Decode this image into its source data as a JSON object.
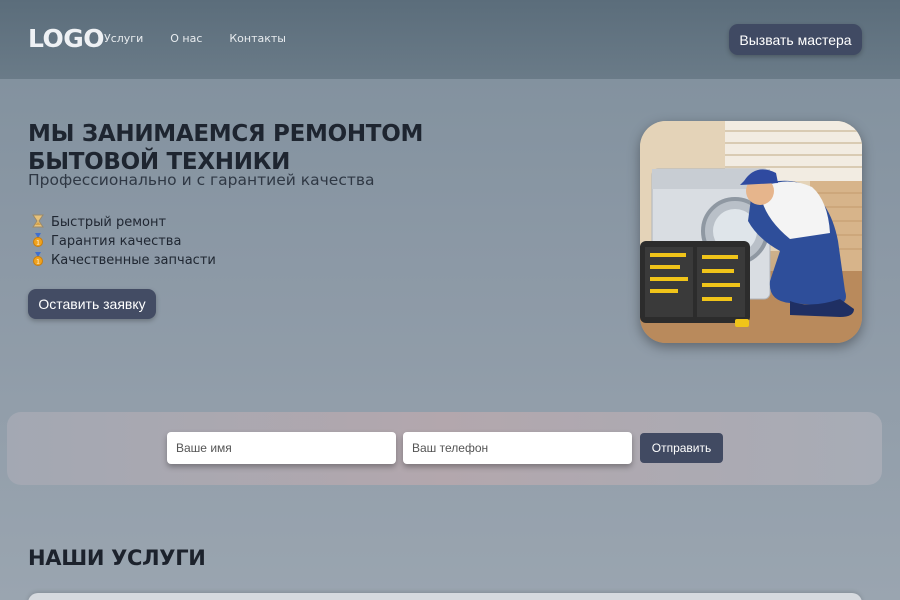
{
  "header": {
    "logo": "LOGO",
    "nav": [
      "Услуги",
      "О нас",
      "Контакты"
    ],
    "cta_label": "Вызвать мастера"
  },
  "hero": {
    "title": "МЫ ЗАНИМАЕМСЯ РЕМОНТОМ БЫТОВОЙ ТЕХНИКИ",
    "subtitle": "Профессионально и с гарантией качества",
    "features": [
      {
        "icon": "hourglass-icon",
        "label": "Быстрый ремонт"
      },
      {
        "icon": "medal-icon",
        "label": "Гарантия качества"
      },
      {
        "icon": "medal-icon",
        "label": "Качественные запчасти"
      }
    ],
    "order_label": "Оставить заявку"
  },
  "form": {
    "name_placeholder": "Ваше имя",
    "phone_placeholder": "Ваш телефон",
    "submit_label": "Отправить"
  },
  "services": {
    "title": "НАШИ УСЛУГИ"
  },
  "colors": {
    "header_bg": "#5b6d7b",
    "button_bg": "#404a63",
    "page_bg": "#8b98a5"
  }
}
